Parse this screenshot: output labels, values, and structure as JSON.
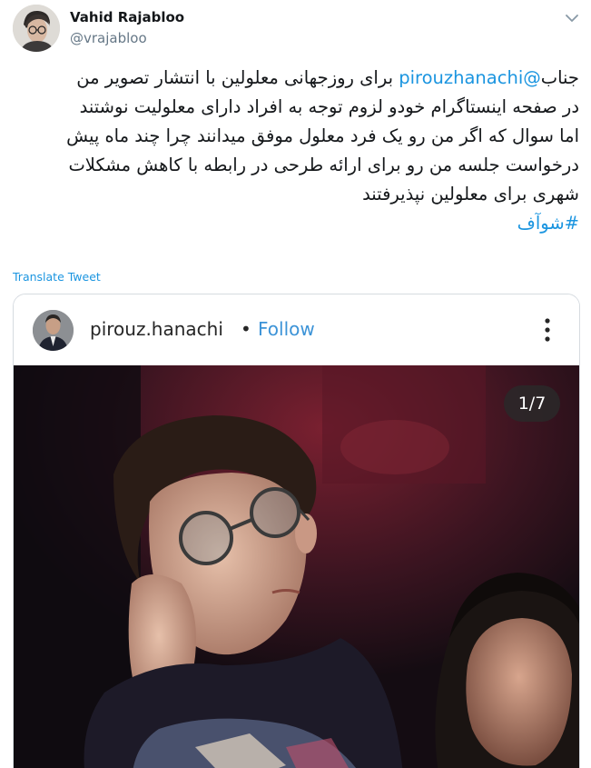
{
  "author": {
    "name": "Vahid Rajabloo",
    "handle": "@vrajabloo"
  },
  "tweet": {
    "line1_prefix": "جناب",
    "mention": "@pirouzhanachi",
    "line1_suffix": " برای روزجهانی معلولین با انتشار تصویر من",
    "line2": "در صفحه اینستاگرام خودو لزوم توجه به افراد دارای معلولیت نوشتند",
    "line3": "اما سوال که اگر من رو یک فرد معلول موفق میدانند چرا چند ماه پیش",
    "line4": "درخواست جلسه من رو برای ارائه طرحی در رابطه با کاهش مشکلات",
    "line5": "شهری برای معلولین نپذیرفتند",
    "hashtag": "#شوآف"
  },
  "translate_label": "Translate Tweet",
  "embed": {
    "username": "pirouz.hanachi",
    "separator": "•",
    "follow_label": "Follow",
    "counter": "1/7"
  },
  "icons": {
    "caret": "chevron-down-icon",
    "more": "vertical-dots-icon"
  },
  "colors": {
    "link": "#1b95e0",
    "follow": "#3c93d7",
    "handle": "#657786"
  }
}
